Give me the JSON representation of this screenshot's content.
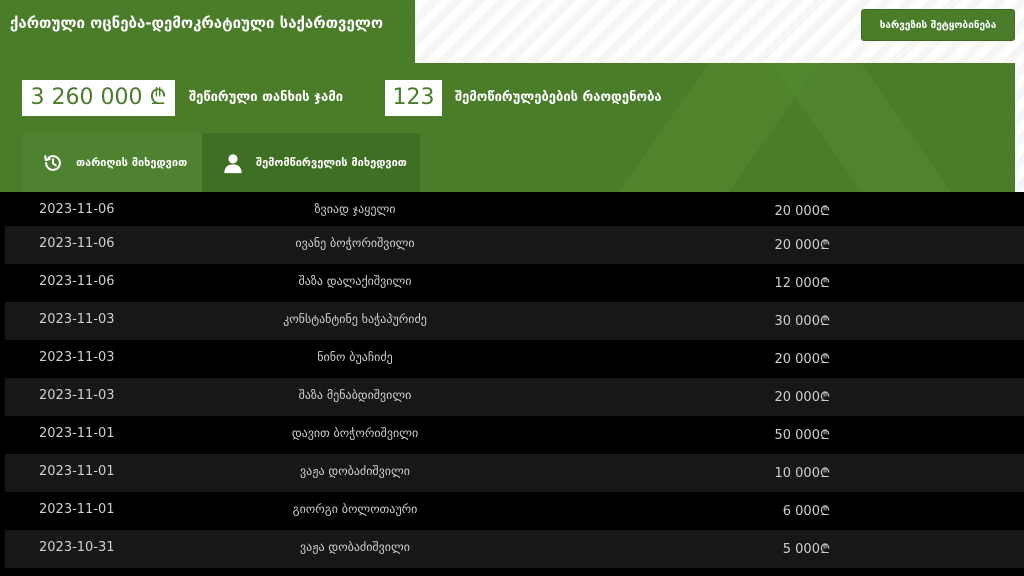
{
  "header": {
    "party_name": "ქართული ოცნება-დემოკრატიული საქართველო",
    "report_button": "ხარვეზის შეტყობინება"
  },
  "stats": {
    "total_sum": "3 260 000 ₾",
    "total_sum_label": "შეწირული თანხის ჯამი",
    "donations_count": "123",
    "donations_count_label": "შემოწირულებების რაოდენობა"
  },
  "tabs": [
    {
      "label": "თარიღის მიხედვით",
      "icon": "history-icon",
      "active": true
    },
    {
      "label": "შემომწირველის მიხედვით",
      "icon": "user-icon",
      "active": false
    }
  ],
  "donations": [
    {
      "date": "2023-11-06",
      "name": "ზვიად ჯაყელი",
      "amount": "20 000₾"
    },
    {
      "date": "2023-11-06",
      "name": "ივანე ბოჭორიშვილი",
      "amount": "20 000₾"
    },
    {
      "date": "2023-11-06",
      "name": "შაზა დალაქიშვილი",
      "amount": "12 000₾"
    },
    {
      "date": "2023-11-03",
      "name": "კონსტანტინე ხაჭაპურიძე",
      "amount": "30 000₾"
    },
    {
      "date": "2023-11-03",
      "name": "ნინო ბუაჩიძე",
      "amount": "20 000₾"
    },
    {
      "date": "2023-11-03",
      "name": "შაზა მენაბდიშვილი",
      "amount": "20 000₾"
    },
    {
      "date": "2023-11-01",
      "name": "დავით ბოჭორიშვილი",
      "amount": "50 000₾"
    },
    {
      "date": "2023-11-01",
      "name": "ვაჟა დობაძიშვილი",
      "amount": "10 000₾"
    },
    {
      "date": "2023-11-01",
      "name": "გიორგი ბოლოთაური",
      "amount": "6 000₾"
    },
    {
      "date": "2023-10-31",
      "name": "ვაჟა დობაძიშვილი",
      "amount": "5 000₾"
    }
  ],
  "colors": {
    "brand_green": "#4a7c2a",
    "table_background": "#000000",
    "row_alt": "#171717"
  }
}
